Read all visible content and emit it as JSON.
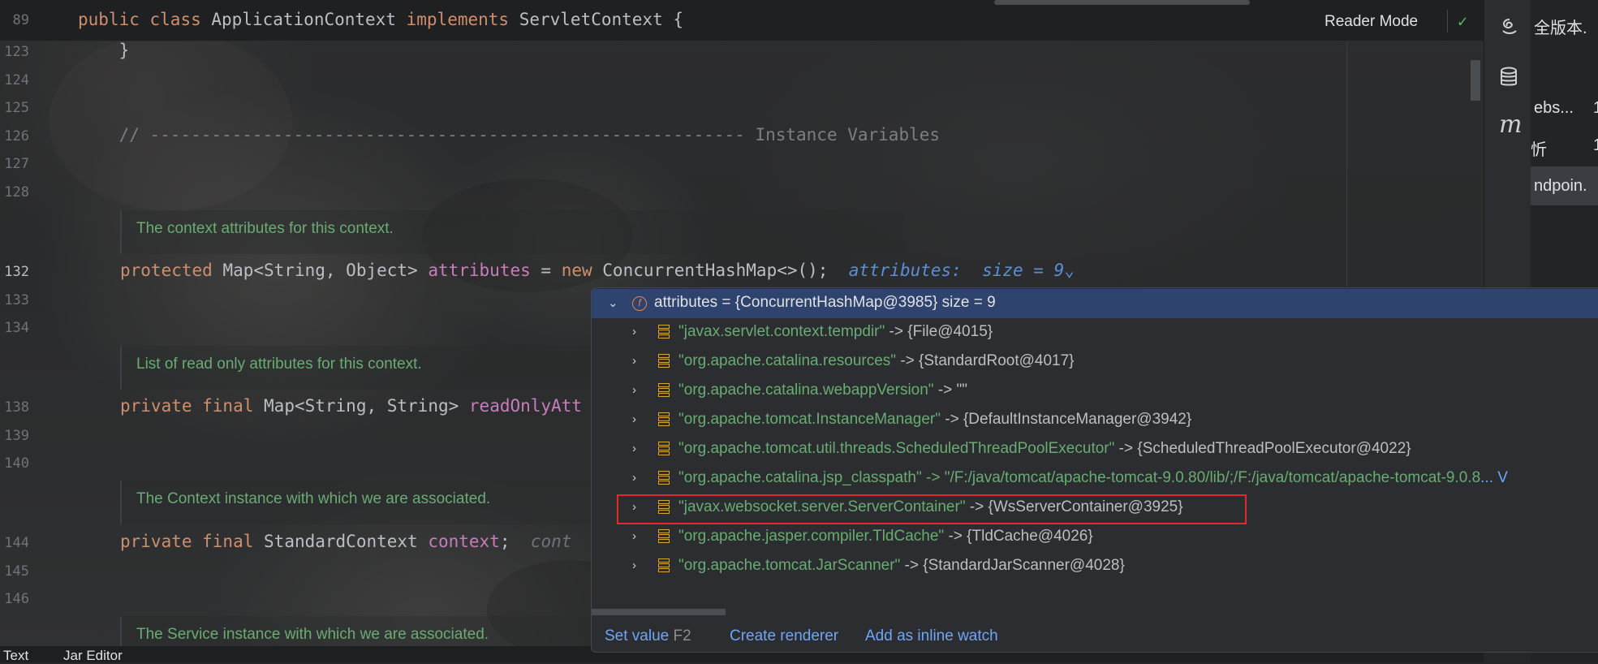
{
  "editor": {
    "sticky": {
      "line": "89",
      "code": [
        "public",
        "class",
        "ApplicationContext",
        "implements",
        "ServletContext",
        "{"
      ]
    },
    "lines": [
      {
        "n": "123",
        "text": "    }"
      },
      {
        "n": "124",
        "text": ""
      },
      {
        "n": "125",
        "text": ""
      },
      {
        "n": "126",
        "text": "    // ---------------------------------------------------------- Instance Variables"
      },
      {
        "n": "127",
        "text": ""
      },
      {
        "n": "128",
        "text": ""
      },
      {
        "n": "132",
        "kw": "protected",
        "type": "Map<String, Object>",
        "field": "attributes",
        "rest": " = ",
        "kw2": "new",
        "rest2": " ConcurrentHashMap<>();",
        "hint": "attributes:  size = 9"
      },
      {
        "n": "133",
        "text": ""
      },
      {
        "n": "134",
        "text": ""
      },
      {
        "n": "138",
        "kw": "private final",
        "type": "Map<String, String>",
        "field": "readOnlyAtt"
      },
      {
        "n": "139",
        "text": ""
      },
      {
        "n": "140",
        "text": ""
      },
      {
        "n": "144",
        "kw": "private final",
        "type": "StandardContext",
        "field": "context",
        "rest": ";",
        "hint": "cont"
      },
      {
        "n": "145",
        "text": ""
      },
      {
        "n": "146",
        "text": ""
      }
    ],
    "docs": [
      "The context attributes for this context.",
      "List of read only attributes for this context.",
      "The Context instance with which we are associated.",
      "The Service instance with which we are associated."
    ],
    "reader_mode": "Reader Mode"
  },
  "debug_popup": {
    "root": {
      "name": "attributes",
      "value": " = {ConcurrentHashMap@3985}",
      "size": "  size = 9"
    },
    "entries": [
      {
        "key": "\"javax.servlet.context.tempdir\"",
        "value": " -> {File@4015}"
      },
      {
        "key": "\"org.apache.catalina.resources\"",
        "value": " -> {StandardRoot@4017}"
      },
      {
        "key": "\"org.apache.catalina.webappVersion\"",
        "value": " -> \"\""
      },
      {
        "key": "\"org.apache.tomcat.InstanceManager\"",
        "value": " -> {DefaultInstanceManager@3942}"
      },
      {
        "key": "\"org.apache.tomcat.util.threads.ScheduledThreadPoolExecutor\"",
        "value": " -> {ScheduledThreadPoolExecutor@4022}"
      },
      {
        "key": "\"org.apache.catalina.jsp_classpath\"",
        "value": " -> \"/F:/java/tomcat/apache-tomcat-9.0.80/lib/;/F:/java/tomcat/apache-tomcat-9.0.8",
        "link": "... V"
      },
      {
        "key": "\"javax.websocket.server.ServerContainer\"",
        "value": " -> {WsServerContainer@3925}"
      },
      {
        "key": "\"org.apache.jasper.compiler.TldCache\"",
        "value": " -> {TldCache@4026}"
      },
      {
        "key": "\"org.apache.tomcat.JarScanner\"",
        "value": " -> {StandardJarScanner@4028}"
      }
    ],
    "actions": {
      "set_value": "Set value",
      "set_value_key": "F2",
      "create_renderer": "Create renderer",
      "add_watch": "Add as inline watch"
    }
  },
  "right_panel": {
    "items": [
      "全版本.",
      "ebs...",
      "ndpoin."
    ],
    "counts": [
      "1",
      "1"
    ],
    "char": "忻"
  },
  "status_tabs": [
    "Text",
    "Jar Editor"
  ],
  "icons": [
    "ai-assistant-icon",
    "database-icon",
    "maven-icon",
    "chevron-down-icon",
    "chevron-right-icon",
    "field-icon",
    "map-entry-icon",
    "check-icon"
  ]
}
